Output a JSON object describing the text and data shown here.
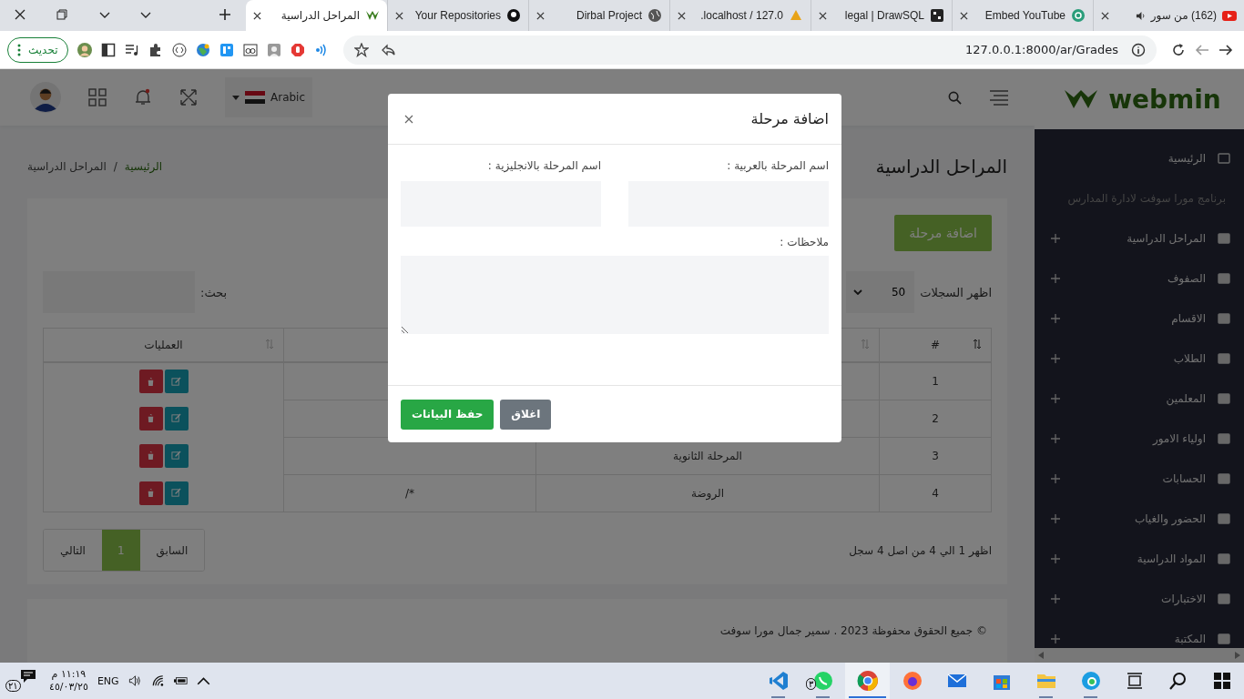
{
  "browser": {
    "tabs": [
      {
        "title": "(162) من سور",
        "selected": false
      },
      {
        "title": "Embed YouTube",
        "selected": false
      },
      {
        "title": "legal | DrawSQL",
        "selected": false
      },
      {
        "title": "localhost / 127.0.",
        "selected": false
      },
      {
        "title": "Dirbal Project",
        "selected": false
      },
      {
        "title": "Your Repositories",
        "selected": false
      },
      {
        "title": "المراحل الدراسية",
        "selected": true
      }
    ],
    "update_button": "تحديث",
    "address": "127.0.0.1:8000/ar/Grades"
  },
  "header": {
    "language": "Arabic",
    "logo": "webmin"
  },
  "sidebar": {
    "items": [
      {
        "kind": "link",
        "label": "الرئيسية",
        "expandable": false
      },
      {
        "kind": "caption",
        "label": "برنامج مورا سوفت لادارة المدارس"
      },
      {
        "kind": "link",
        "label": "المراحل الدراسية",
        "expandable": true
      },
      {
        "kind": "link",
        "label": "الصفوف",
        "expandable": true
      },
      {
        "kind": "link",
        "label": "الاقسام",
        "expandable": true
      },
      {
        "kind": "link",
        "label": "الطلاب",
        "expandable": true
      },
      {
        "kind": "link",
        "label": "المعلمين",
        "expandable": true
      },
      {
        "kind": "link",
        "label": "اولياء الامور",
        "expandable": true
      },
      {
        "kind": "link",
        "label": "الحسابات",
        "expandable": true
      },
      {
        "kind": "link",
        "label": "الحضور والغياب",
        "expandable": true
      },
      {
        "kind": "link",
        "label": "المواد الدراسية",
        "expandable": true
      },
      {
        "kind": "link",
        "label": "الاختبارات",
        "expandable": true
      },
      {
        "kind": "link",
        "label": "المكتبة",
        "expandable": true
      }
    ]
  },
  "page": {
    "title": "المراحل الدراسية",
    "breadcrumb": [
      "الرئيسية",
      "المراحل الدراسية"
    ],
    "breadcrumb_separator": "/",
    "add_button": "اضافة مرحلة",
    "show_records_label": "اظهر السجلات",
    "page_size": "50",
    "search_label": "بحث:",
    "table": {
      "columns": [
        "#",
        "",
        "",
        "العمليات"
      ],
      "rows": [
        {
          "cells": [
            "1",
            "",
            ""
          ]
        },
        {
          "cells": [
            "2",
            "",
            ""
          ]
        },
        {
          "cells": [
            "3",
            "المرحلة الثانوية",
            ""
          ]
        },
        {
          "cells": [
            "4",
            "الروضة",
            "*/"
          ]
        }
      ]
    },
    "info": "اظهر 1 الي 4 من اصل 4 سجل",
    "pagination": [
      {
        "label": "السابق",
        "selected": false
      },
      {
        "label": "1",
        "selected": true
      },
      {
        "label": "التالي",
        "selected": false
      }
    ],
    "footer": "© جميع الحقوق محفوظة 2023 . سمير جمال مورا سوفت"
  },
  "modal": {
    "title": "اضافة مرحلة",
    "name_ar_label": "اسم المرحلة بالعربية :",
    "name_en_label": "اسم المرحلة بالانجليزية :",
    "notes_label": "ملاحظات :",
    "close_button": "اغلاق",
    "save_button": "حفظ البيانات"
  },
  "taskbar": {
    "notifications": "٢١",
    "time": "١١:١٩ م",
    "date": "٤٥/٠٣/٢٥",
    "language": "ENG",
    "apps": [
      {
        "running": true,
        "active": false
      },
      {
        "running": true,
        "active": false,
        "badge": "٣"
      },
      {
        "running": true,
        "active": true
      },
      {
        "running": false,
        "active": false
      },
      {
        "running": false,
        "active": false
      },
      {
        "running": false,
        "active": false
      },
      {
        "running": true,
        "active": false
      },
      {
        "running": true,
        "active": false
      }
    ]
  }
}
